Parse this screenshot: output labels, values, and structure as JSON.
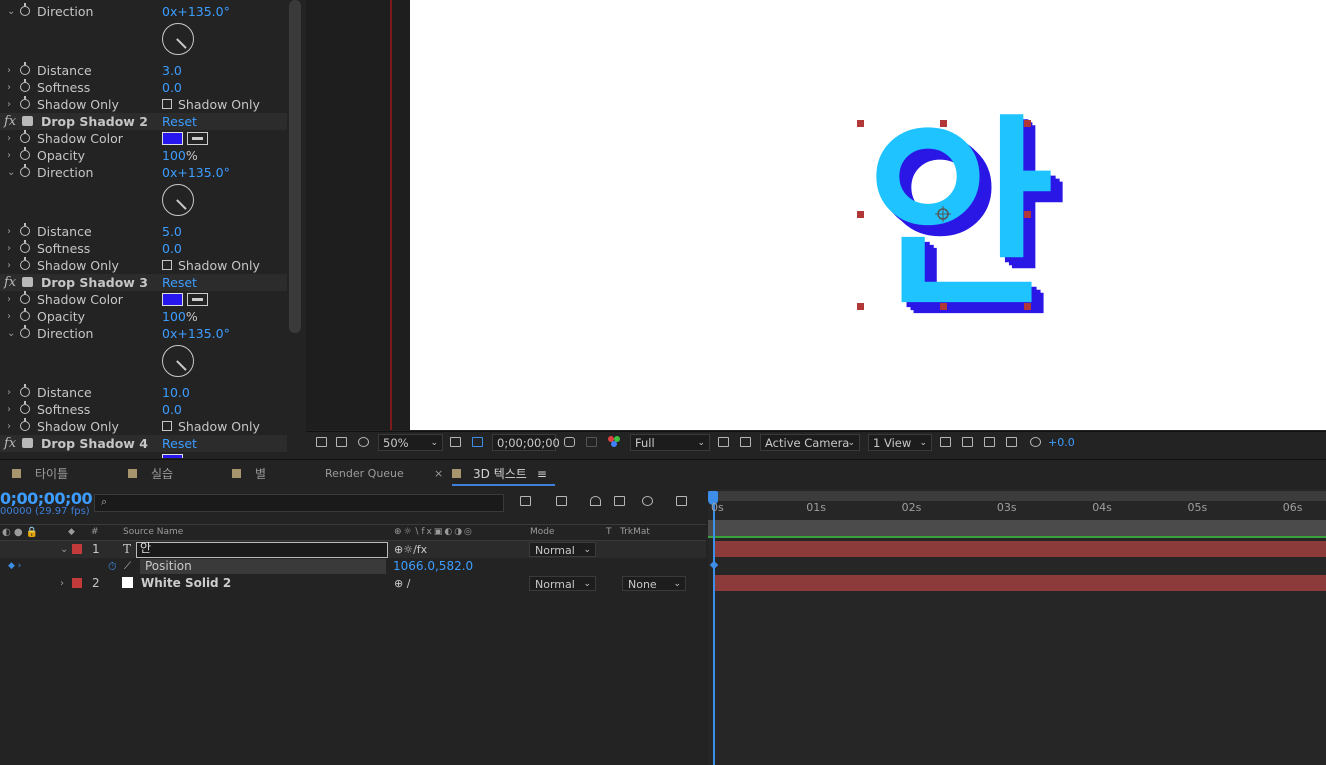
{
  "effect_controls": {
    "rows": [
      {
        "kind": "prop",
        "name": "Direction",
        "value": "0x+135.0°",
        "twirl": "open"
      },
      {
        "kind": "prop",
        "name": "Distance",
        "value": "3.0"
      },
      {
        "kind": "prop",
        "name": "Softness",
        "value": "0.0"
      },
      {
        "kind": "check",
        "name": "Shadow Only",
        "checkbox_label": "Shadow Only"
      },
      {
        "kind": "effect",
        "name": "Drop Shadow 2",
        "reset": "Reset"
      },
      {
        "kind": "color",
        "name": "Shadow Color"
      },
      {
        "kind": "prop",
        "name": "Opacity",
        "value": "100",
        "unit": "%"
      },
      {
        "kind": "prop",
        "name": "Direction",
        "value": "0x+135.0°",
        "twirl": "open"
      },
      {
        "kind": "prop",
        "name": "Distance",
        "value": "5.0"
      },
      {
        "kind": "prop",
        "name": "Softness",
        "value": "0.0"
      },
      {
        "kind": "check",
        "name": "Shadow Only",
        "checkbox_label": "Shadow Only"
      },
      {
        "kind": "effect",
        "name": "Drop Shadow 3",
        "reset": "Reset"
      },
      {
        "kind": "color",
        "name": "Shadow Color"
      },
      {
        "kind": "prop",
        "name": "Opacity",
        "value": "100",
        "unit": "%"
      },
      {
        "kind": "prop",
        "name": "Direction",
        "value": "0x+135.0°",
        "twirl": "open"
      },
      {
        "kind": "prop",
        "name": "Distance",
        "value": "10.0"
      },
      {
        "kind": "prop",
        "name": "Softness",
        "value": "0.0"
      },
      {
        "kind": "check",
        "name": "Shadow Only",
        "checkbox_label": "Shadow Only"
      },
      {
        "kind": "effect",
        "name": "Drop Shadow 4",
        "reset": "Reset"
      }
    ],
    "shadow_color": "#2816ee"
  },
  "viewer": {
    "glyph": "안",
    "glyph_color": "#1ec3ff",
    "extrude_color": "#2a17e6",
    "toolbar": {
      "zoom": "50%",
      "timecode": "0;00;00;00",
      "resolution": "Full",
      "camera": "Active Camera",
      "view": "1 View",
      "exposure": "+0.0"
    }
  },
  "tabs": [
    {
      "label": "타이틀",
      "color": "#a7956d"
    },
    {
      "label": "실습",
      "color": "#a7956d"
    },
    {
      "label": "별",
      "color": "#a7956d"
    },
    {
      "label": "Render Queue"
    },
    {
      "label": "3D 텍스트",
      "color": "#a7956d",
      "active": true
    }
  ],
  "timeline": {
    "timecode": "0;00;00;00",
    "fps": "00000 (29.97 fps)",
    "headers": {
      "source": "Source Name",
      "mode": "Mode",
      "t": "T",
      "trkmat": "TrkMat"
    },
    "layers": [
      {
        "num": "1",
        "type": "T",
        "name": "안",
        "mode": "Normal",
        "label_color": "#c23a3a",
        "bar_color": "#8c3a3a"
      },
      {
        "prop": "Position",
        "value": "1066.0,582.0"
      },
      {
        "num": "2",
        "name": "White Solid 2",
        "mode": "Normal",
        "trkmat": "None",
        "label_color": "#c23a3a",
        "bar_color": "#8c3a3a"
      }
    ],
    "ruler": [
      "0s",
      "01s",
      "02s",
      "03s",
      "04s",
      "05s",
      "06s"
    ]
  }
}
